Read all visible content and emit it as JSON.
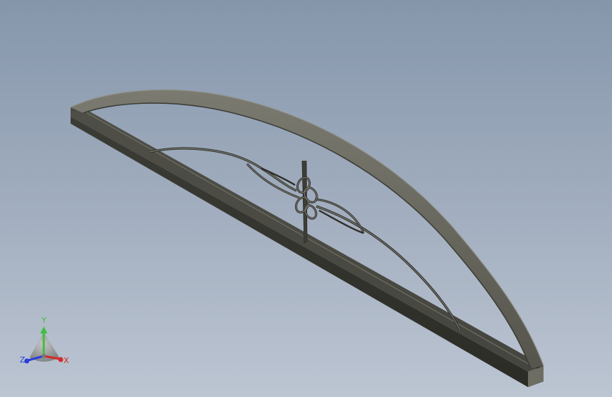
{
  "viewport": {
    "background_top": "#8596ab",
    "background_bottom": "#bcc5d2"
  },
  "model": {
    "frame_color": "#5a5a52",
    "frame_dark": "#3a3a34",
    "frame_light": "#8a8a80"
  },
  "triad": {
    "labels": {
      "x": "X",
      "y": "Y",
      "z": "Z"
    },
    "colors": {
      "x": "#d22a2a",
      "y": "#3fbf3a",
      "z": "#2a3fd8"
    }
  }
}
